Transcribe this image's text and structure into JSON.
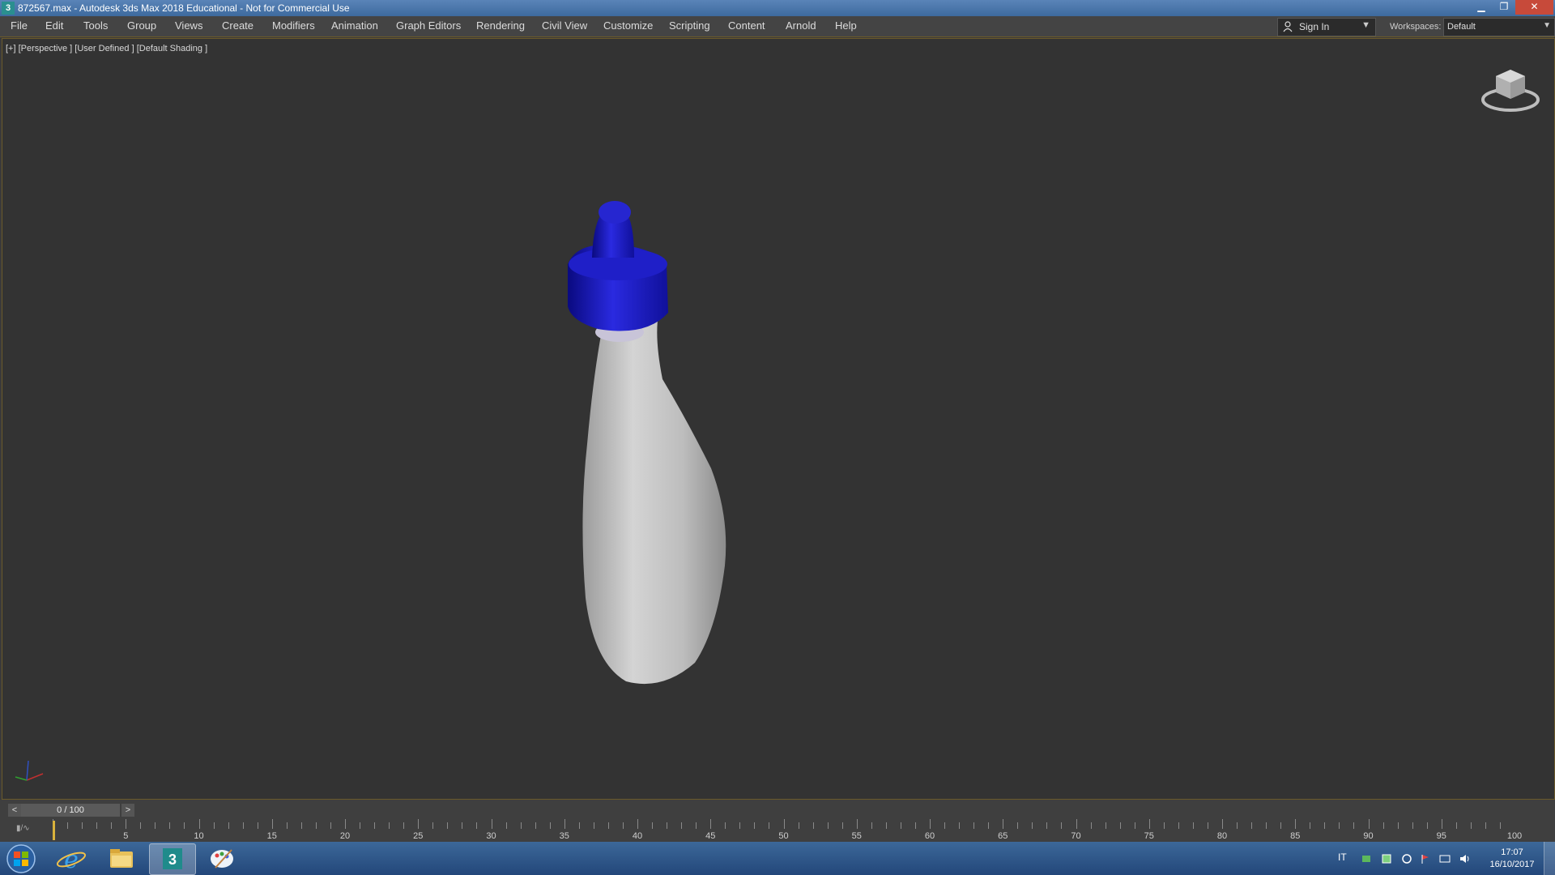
{
  "window": {
    "title": "872567.max - Autodesk 3ds Max 2018 Educational - Not for Commercial Use",
    "app_icon_glyph": "3",
    "min_glyph": "▁",
    "max_glyph": "❐",
    "close_glyph": "✕"
  },
  "menu": {
    "items": [
      "File",
      "Edit",
      "Tools",
      "Group",
      "Views",
      "Create",
      "Modifiers",
      "Animation",
      "Graph Editors",
      "Rendering",
      "Civil View",
      "Customize",
      "Scripting",
      "Content",
      "Arnold",
      "Help"
    ]
  },
  "account": {
    "sign_in_label": "Sign In",
    "workspaces_label": "Workspaces:",
    "workspace_value": "Default"
  },
  "viewport": {
    "label": "[+] [Perspective ] [User Defined ] [Default Shading ]",
    "background": "#333333",
    "bottle_color": "#c8c8c8",
    "cap_color": "#1a1ab8"
  },
  "timeline": {
    "frame_display": "0 / 100",
    "prev_glyph": "<",
    "next_glyph": ">",
    "ticks": [
      "5",
      "10",
      "15",
      "20",
      "25",
      "30",
      "35",
      "40",
      "45",
      "50",
      "55",
      "60",
      "65",
      "70",
      "75",
      "80",
      "85",
      "90",
      "95",
      "100"
    ]
  },
  "taskbar": {
    "language": "IT",
    "time": "17:07",
    "date": "16/10/2017"
  }
}
